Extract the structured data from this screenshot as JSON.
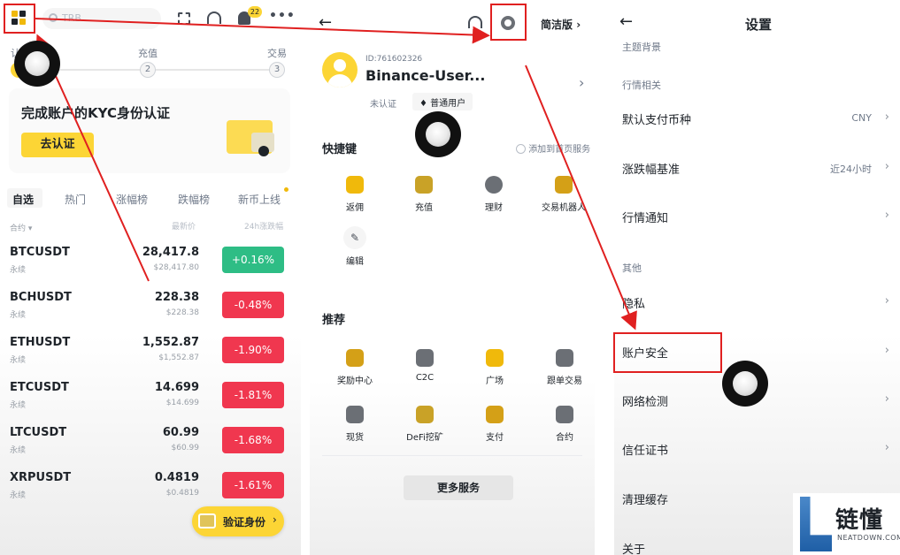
{
  "panel1": {
    "search_placeholder": "TRB",
    "notif_count": "22",
    "steps": {
      "label1": "认",
      "label2": "充值",
      "label3": "交易",
      "num2": "2",
      "num3": "3"
    },
    "kyc_title": "完成账户的KYC身份认证",
    "kyc_button": "去认证",
    "tabs": [
      "自选",
      "热门",
      "涨幅榜",
      "跌幅榜",
      "新币上线"
    ],
    "col_pair": "合约",
    "col_price": "最新价",
    "col_change": "24h涨跌幅",
    "rows": [
      {
        "name": "BTCUSDT",
        "sub": "永续",
        "price": "28,417.8",
        "price_sub": "$28,417.80",
        "change": "+0.16%",
        "dir": "up"
      },
      {
        "name": "BCHUSDT",
        "sub": "永续",
        "price": "228.38",
        "price_sub": "$228.38",
        "change": "-0.48%",
        "dir": "down"
      },
      {
        "name": "ETHUSDT",
        "sub": "永续",
        "price": "1,552.87",
        "price_sub": "$1,552.87",
        "change": "-1.90%",
        "dir": "down"
      },
      {
        "name": "ETCUSDT",
        "sub": "永续",
        "price": "14.699",
        "price_sub": "$14.699",
        "change": "-1.81%",
        "dir": "down"
      },
      {
        "name": "LTCUSDT",
        "sub": "永续",
        "price": "60.99",
        "price_sub": "$60.99",
        "change": "-1.68%",
        "dir": "down"
      },
      {
        "name": "XRPUSDT",
        "sub": "永续",
        "price": "0.4819",
        "price_sub": "$0.4819",
        "change": "-1.61%",
        "dir": "down"
      }
    ],
    "verify_button": "验证身份"
  },
  "panel2": {
    "lite_label": "简洁版",
    "user_id": "ID:761602326",
    "username": "Binance-User...",
    "badge_unverified": "未认证",
    "badge_regular": "普通用户",
    "shortcuts_title": "快捷键",
    "add_home_label": "添加到首页服务",
    "shortcuts": [
      "返佣",
      "充值",
      "理财",
      "交易机器人"
    ],
    "edit_label": "编辑",
    "recommend_title": "推荐",
    "recommend": [
      "奖励中心",
      "C2C",
      "广场",
      "跟单交易",
      "现货",
      "DeFi挖矿",
      "支付",
      "合约"
    ],
    "more_button": "更多服务"
  },
  "panel3": {
    "title": "设置",
    "theme_label": "主题背景",
    "group_market": "行情相关",
    "items_market": [
      {
        "label": "默认支付币种",
        "value": "CNY"
      },
      {
        "label": "涨跌幅基准",
        "value": "近24小时"
      },
      {
        "label": "行情通知",
        "value": ""
      }
    ],
    "group_other": "其他",
    "items_other": [
      "隐私",
      "账户安全",
      "网络检测",
      "信任证书",
      "清理缓存",
      "关于"
    ]
  },
  "watermark": {
    "text": "链懂",
    "sub": "NEATDOWN.COM"
  },
  "colors": {
    "accent": "#fcd535",
    "up": "#2ebd85",
    "down": "#f0374f",
    "highlight": "#e02020"
  }
}
